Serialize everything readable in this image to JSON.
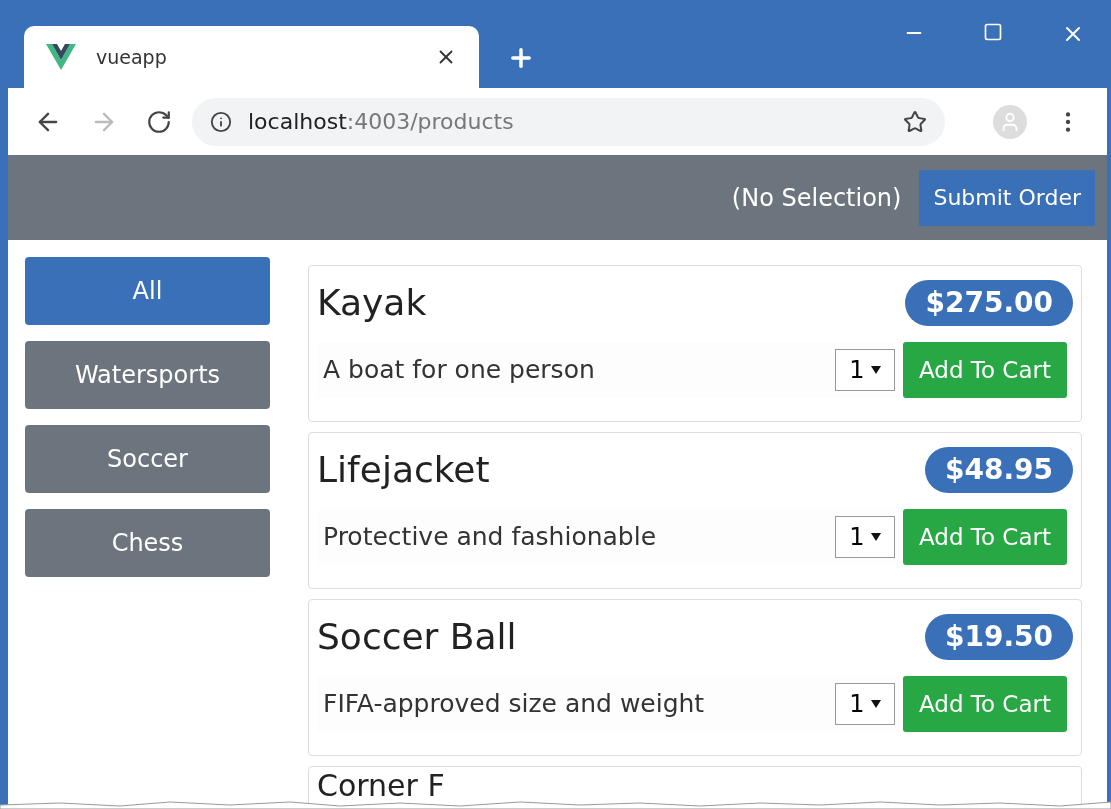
{
  "browser": {
    "tab": {
      "title": "vueapp"
    },
    "address": {
      "host": "localhost",
      "path": ":4003/products"
    }
  },
  "navbar": {
    "selection": "(No Selection)",
    "submit": "Submit Order"
  },
  "categories": [
    {
      "label": "All",
      "selected": true
    },
    {
      "label": "Watersports",
      "selected": false
    },
    {
      "label": "Soccer",
      "selected": false
    },
    {
      "label": "Chess",
      "selected": false
    }
  ],
  "products": [
    {
      "name": "Kayak",
      "price": "$275.00",
      "description": "A boat for one person",
      "quantity": "1",
      "button": "Add To Cart"
    },
    {
      "name": "Lifejacket",
      "price": "$48.95",
      "description": "Protective and fashionable",
      "quantity": "1",
      "button": "Add To Cart"
    },
    {
      "name": "Soccer Ball",
      "price": "$19.50",
      "description": "FIFA-approved size and weight",
      "quantity": "1",
      "button": "Add To Cart"
    }
  ],
  "partial_product": {
    "name": "Corner F"
  }
}
